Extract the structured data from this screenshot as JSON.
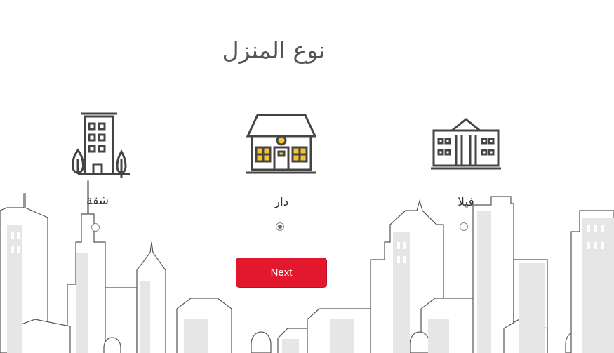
{
  "page": {
    "title": "نوع المنزل"
  },
  "options": [
    {
      "label": "شقة",
      "icon": "apartment-building-icon",
      "selected": false
    },
    {
      "label": "دار",
      "icon": "house-icon",
      "selected": true
    },
    {
      "label": "فيلا",
      "icon": "villa-icon",
      "selected": false
    }
  ],
  "next_button": {
    "label": "Next"
  },
  "colors": {
    "accent": "#e3172e",
    "window_highlight": "#f4c430",
    "icon_stroke": "#444444",
    "background_buildings": "#e6e6e6"
  }
}
